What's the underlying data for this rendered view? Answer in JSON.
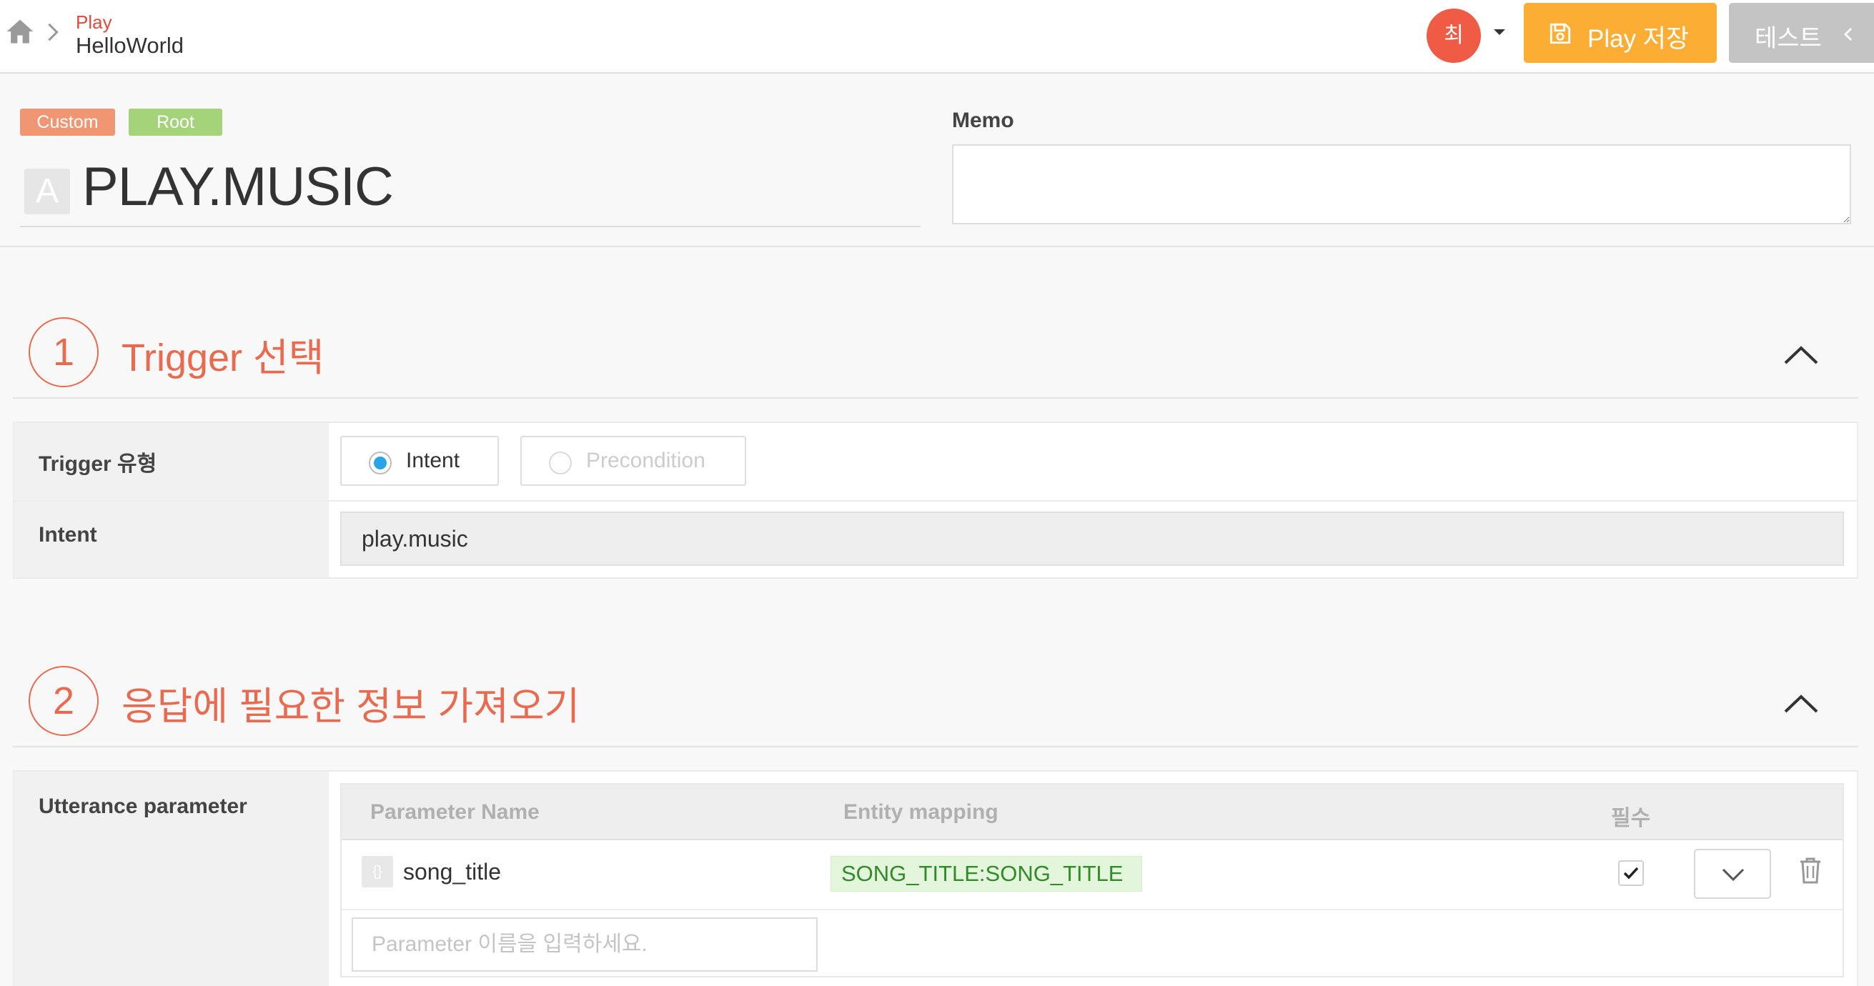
{
  "breadcrumb": {
    "parent": "Play",
    "current": "HelloWorld"
  },
  "user": {
    "avatar_initial": "최"
  },
  "actions": {
    "save_label": "Play 저장",
    "test_label": "테스트"
  },
  "play": {
    "badges": [
      "Custom",
      "Root"
    ],
    "title_icon_letter": "A",
    "title": "PLAY.MUSIC",
    "memo_label": "Memo",
    "memo_value": ""
  },
  "sections": [
    {
      "number": "1",
      "title": "Trigger 선택",
      "rows": {
        "trigger_type_label": "Trigger 유형",
        "options": [
          {
            "label": "Intent",
            "selected": true
          },
          {
            "label": "Precondition",
            "selected": false
          }
        ],
        "intent_label": "Intent",
        "intent_value": "play.music"
      }
    },
    {
      "number": "2",
      "title": "응답에 필요한 정보 가져오기",
      "utterance_label": "Utterance parameter",
      "table": {
        "headers": [
          "Parameter Name",
          "Entity mapping",
          "필수"
        ],
        "rows": [
          {
            "icon_text": "{}",
            "name": "song_title",
            "entity": "SONG_TITLE:SONG_TITLE",
            "required": true
          }
        ],
        "new_param_placeholder": "Parameter 이름을 입력하세요."
      }
    }
  ],
  "colors": {
    "accent": "#e96a4e",
    "save": "#fcad33",
    "test": "#c4c4c4",
    "badge_custom": "#f09673",
    "badge_root": "#a5d379",
    "radio_on": "#2aa4e8",
    "entity_bg": "#e3f6dc",
    "entity_text": "#338a29"
  }
}
